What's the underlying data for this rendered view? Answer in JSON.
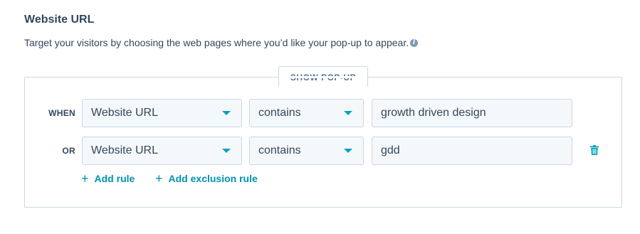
{
  "section": {
    "title": "Website URL",
    "description": "Target your visitors by choosing the web pages where you’d like your pop-up to appear.",
    "info_icon": "info-icon"
  },
  "panel": {
    "tab_label": "SHOW POP-UP"
  },
  "rules": [
    {
      "connector": "WHEN",
      "field": "Website URL",
      "operator": "contains",
      "value": "growth driven design"
    },
    {
      "connector": "OR",
      "field": "Website URL",
      "operator": "contains",
      "value": "gdd"
    }
  ],
  "actions": {
    "add_rule": "Add rule",
    "add_exclusion_rule": "Add exclusion rule"
  },
  "colors": {
    "accent": "#00a4bd",
    "link": "#0091ae",
    "text": "#33475b",
    "border": "#cbd6e2",
    "field_bg": "#f5f8fa"
  }
}
